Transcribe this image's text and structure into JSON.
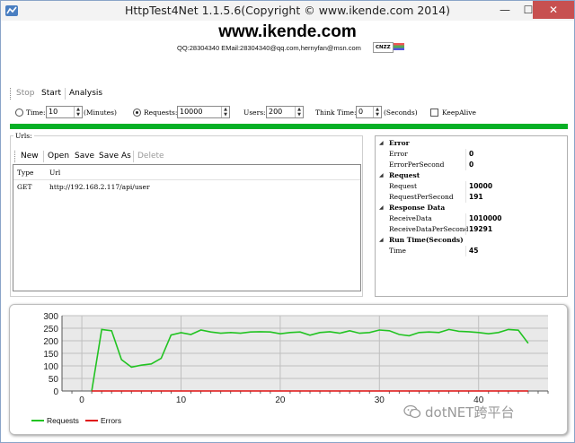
{
  "window": {
    "title": "HttpTest4Net 1.1.5.6(Copyright © www.ikende.com  2014)",
    "controls": {
      "minimize": "—",
      "maximize": "☐",
      "close": "✕"
    }
  },
  "header": {
    "brand": "www.ikende.com",
    "contact": "QQ:28304340 EMail:28304340@qq.com,hernyfan@msn.com",
    "badge": "CNZZ"
  },
  "toolbar": {
    "stop": "Stop",
    "start": "Start",
    "analysis": "Analysis"
  },
  "options": {
    "time_label": "Time:",
    "time_value": "10",
    "minutes_label": "(Minutes)",
    "requests_label": "Requests:",
    "requests_value": "10000",
    "users_label": "Users:",
    "users_value": "200",
    "think_label": "Think Time:",
    "think_value": "0",
    "seconds_label": "(Seconds)",
    "keepalive_label": "KeepAlive",
    "mode_selected": "requests",
    "keepalive_checked": false
  },
  "progress": {
    "fraction": 1.0,
    "color": "#06b025"
  },
  "urls": {
    "legend": "Urls:",
    "toolbar": {
      "new": "New",
      "open": "Open",
      "save": "Save",
      "save_as": "Save As",
      "delete": "Delete"
    },
    "columns": [
      "Type",
      "Url"
    ],
    "rows": [
      {
        "type": "GET",
        "url": "http://192.168.2.117/api/user"
      }
    ]
  },
  "properties": {
    "categories": [
      {
        "name": "Error",
        "items": [
          {
            "key": "Error",
            "value": "0"
          },
          {
            "key": "ErrorPerSecond",
            "value": "0"
          }
        ]
      },
      {
        "name": "Request",
        "items": [
          {
            "key": "Request",
            "value": "10000"
          },
          {
            "key": "RequestPerSecond",
            "value": "191"
          }
        ]
      },
      {
        "name": "Response Data",
        "items": [
          {
            "key": "ReceiveData",
            "value": "1010000"
          },
          {
            "key": "ReceiveDataPerSecond",
            "value": "19291"
          }
        ]
      },
      {
        "name": "Run Time(Seconds)",
        "items": [
          {
            "key": "Time",
            "value": "45"
          }
        ]
      }
    ]
  },
  "chart_data": {
    "type": "line",
    "ylim": [
      0,
      300
    ],
    "xlim": [
      -2,
      47
    ],
    "y_ticks": [
      "0",
      "50",
      "100",
      "150",
      "200",
      "250",
      "300"
    ],
    "x_ticks": [
      "0",
      "10",
      "20",
      "30",
      "40"
    ],
    "x_tick_values": [
      0,
      10,
      20,
      30,
      40
    ],
    "grid": true,
    "legend_placement": "bottom-left",
    "series": [
      {
        "name": "Requests",
        "color": "#22c322",
        "x": [
          1,
          2,
          3,
          4,
          5,
          6,
          7,
          8,
          9,
          10,
          11,
          12,
          13,
          14,
          15,
          16,
          17,
          18,
          19,
          20,
          21,
          22,
          23,
          24,
          25,
          26,
          27,
          28,
          29,
          30,
          31,
          32,
          33,
          34,
          35,
          36,
          37,
          38,
          39,
          40,
          41,
          42,
          43,
          44,
          45
        ],
        "values": [
          0,
          245,
          240,
          125,
          95,
          103,
          108,
          130,
          223,
          232,
          225,
          243,
          235,
          230,
          233,
          230,
          235,
          236,
          235,
          228,
          233,
          235,
          222,
          233,
          236,
          230,
          240,
          230,
          233,
          243,
          240,
          225,
          220,
          233,
          235,
          233,
          245,
          238,
          236,
          233,
          228,
          233,
          245,
          242,
          190
        ]
      },
      {
        "name": "Errors",
        "color": "#e01010",
        "x": [
          1,
          45
        ],
        "values": [
          0,
          0
        ]
      }
    ]
  },
  "watermark": {
    "text": "dotNET跨平台"
  }
}
